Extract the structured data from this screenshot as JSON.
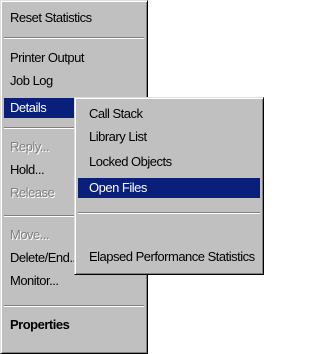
{
  "context_menu": {
    "items": [
      {
        "label": "Reset Statistics",
        "state": "enabled"
      },
      {
        "label": "Printer Output",
        "state": "enabled"
      },
      {
        "label": "Job Log",
        "state": "enabled"
      },
      {
        "label": "Details",
        "state": "selected",
        "has_submenu": true
      },
      {
        "label": "Reply...",
        "state": "disabled"
      },
      {
        "label": "Hold...",
        "state": "enabled"
      },
      {
        "label": "Release",
        "state": "disabled"
      },
      {
        "label": "Move...",
        "state": "disabled"
      },
      {
        "label": "Delete/End...",
        "state": "enabled"
      },
      {
        "label": "Monitor...",
        "state": "enabled"
      },
      {
        "label": "Properties",
        "state": "enabled",
        "bold": true
      }
    ]
  },
  "details_submenu": {
    "items": [
      {
        "label": "Call Stack",
        "state": "enabled"
      },
      {
        "label": "Library List",
        "state": "enabled"
      },
      {
        "label": "Locked Objects",
        "state": "enabled"
      },
      {
        "label": "Open Files",
        "state": "selected"
      },
      {
        "label": "Elapsed Performance Statistics",
        "state": "enabled"
      }
    ]
  },
  "colors": {
    "menu_background": "#c0c0c0",
    "highlight": "#0a1f7a",
    "highlight_text": "#ffffff",
    "disabled_text": "#808080"
  }
}
